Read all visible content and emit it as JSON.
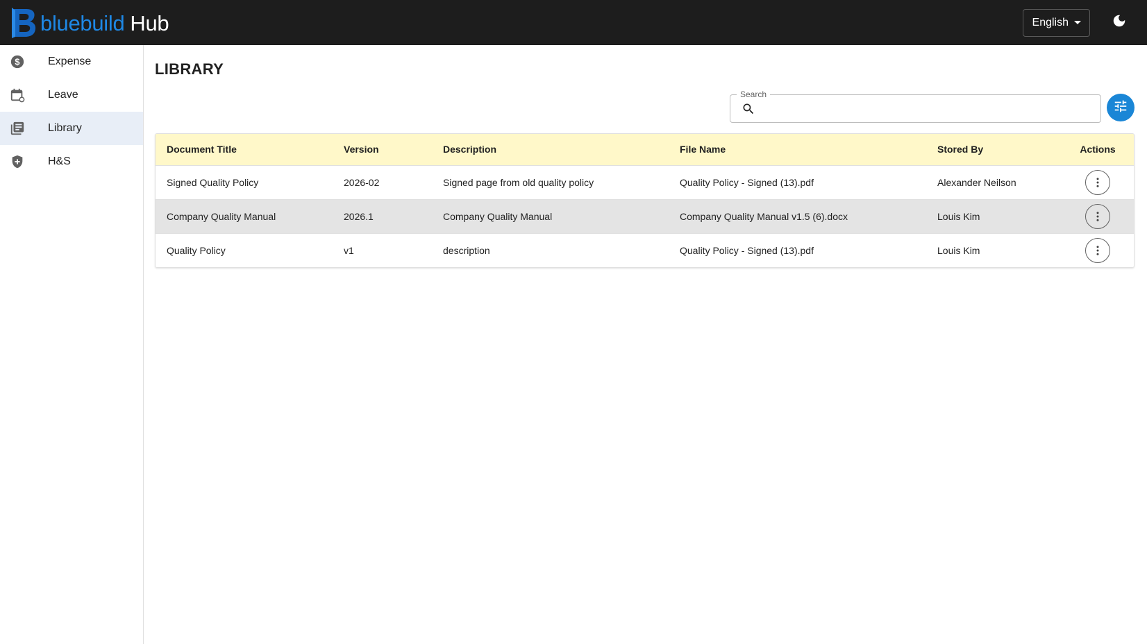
{
  "app": {
    "logo_main": "bluebuild",
    "logo_sub": "Hub"
  },
  "header": {
    "language": "English",
    "theme_icon": "moon-icon"
  },
  "sidebar": {
    "items": [
      {
        "label": "Expense",
        "icon": "dollar-circle-icon"
      },
      {
        "label": "Leave",
        "icon": "calendar-icon"
      },
      {
        "label": "Library",
        "icon": "library-books-icon"
      },
      {
        "label": "H&S",
        "icon": "shield-plus-icon"
      }
    ]
  },
  "page": {
    "title": "LIBRARY"
  },
  "search": {
    "label": "Search",
    "value": ""
  },
  "table": {
    "columns": [
      "Document Title",
      "Version",
      "Description",
      "File Name",
      "Stored By",
      "Actions"
    ],
    "rows": [
      [
        "Signed Quality Policy",
        "2026-02",
        "Signed page from old quality policy",
        "Quality Policy - Signed (13).pdf",
        "Alexander Neilson"
      ],
      [
        "Company Quality Manual",
        "2026.1",
        "Company Quality Manual",
        "Company Quality Manual v1.5 (6).docx",
        "Louis Kim"
      ],
      [
        "Quality Policy",
        "v1",
        "description",
        "Quality Policy - Signed (13).pdf",
        "Louis Kim"
      ]
    ]
  },
  "colors": {
    "topbar": "#1d1d1d",
    "brand_blue": "#1e88e5",
    "header_row": "#fff8c9",
    "active_nav": "#e8eef7",
    "filter_button": "#1a86d6"
  }
}
